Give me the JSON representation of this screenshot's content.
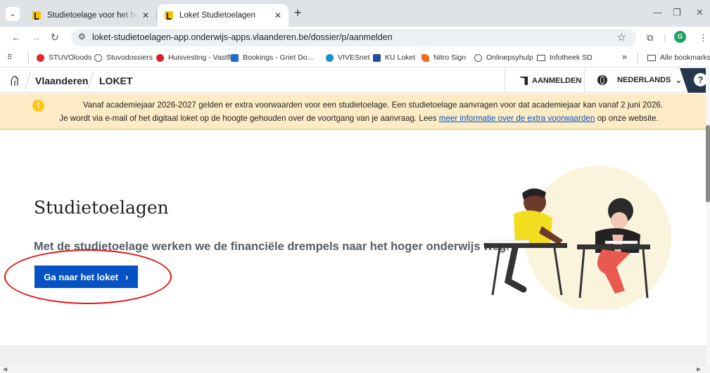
{
  "browser": {
    "tabs": [
      {
        "title": "Studietoelage voor het hoger onderwijs",
        "active": false
      },
      {
        "title": "Loket Studietoelagen",
        "active": true
      }
    ],
    "new_tab_symbol": "+",
    "address": "loket-studietoelagen-app.onderwijs-apps.vlaanderen.be/dossier/p/aanmelden",
    "profile_initial": "G",
    "bookmarks": [
      {
        "label": "STUVOloods",
        "icon": "red-dot-icon"
      },
      {
        "label": "Stuvodossiers",
        "icon": "globe-icon"
      },
      {
        "label": "Huisvesting - Vastfl...",
        "icon": "heart-icon"
      },
      {
        "label": "Bookings - Griet Do...",
        "icon": "outlook-icon"
      },
      {
        "label": "VIVESnet",
        "icon": "vives-icon"
      },
      {
        "label": "KU Loket",
        "icon": "ku-icon"
      },
      {
        "label": "Nitro Sign",
        "icon": "nitro-icon"
      },
      {
        "label": "Onlinepsyhulp",
        "icon": "globe-icon"
      },
      {
        "label": "Infotheek SD",
        "icon": "folder-icon"
      }
    ],
    "bookmarks_overflow": "»",
    "all_bookmarks": "Alle bookmarks"
  },
  "header": {
    "brand": "Vlaanderen",
    "app": "LOKET",
    "login": "AANMELDEN",
    "language": "NEDERLANDS",
    "help": "?"
  },
  "alert": {
    "line1": "Vanaf academiejaar 2026-2027 gelden er extra voorwaarden voor een studietoelage. Een studietoelage aanvragen voor dat academiejaar kan vanaf 2 juni 2026.",
    "line2_before": "Je wordt via e-mail of het digitaal loket op de hoogte gehouden over de voortgang van je aanvraag. Lees ",
    "link": "meer informatie over de extra voorwaarden",
    "line2_after": " op onze website."
  },
  "hero": {
    "title": "Studietoelagen",
    "subtitle": "Met de studietoelage werken we de financiële drempels naar het hoger onderwijs weg.",
    "cta": "Ga naar het loket",
    "cta_arrow": "›"
  },
  "colors": {
    "cta": "#0652c2",
    "alert_bg": "#fcebc5",
    "annotation": "#e01616",
    "help_bg": "#24364b"
  }
}
